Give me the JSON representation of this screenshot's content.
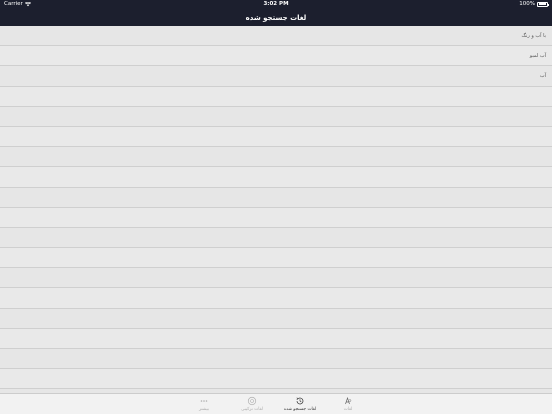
{
  "status_bar": {
    "carrier": "Carrier",
    "time": "3:02 PM",
    "battery": "100%"
  },
  "nav": {
    "title": "لغات جستجو شده"
  },
  "list": {
    "items": [
      "با آب و رنگ",
      "آب لمبو",
      "آب"
    ]
  },
  "tabs": [
    {
      "label": "بیشتر",
      "icon": "more-icon",
      "active": false
    },
    {
      "label": "لغات ترکیبی",
      "icon": "compound-icon",
      "active": false
    },
    {
      "label": "لغات جستجو شده",
      "icon": "history-icon",
      "active": true
    },
    {
      "label": "لغات",
      "icon": "letters-icon",
      "active": false
    }
  ]
}
